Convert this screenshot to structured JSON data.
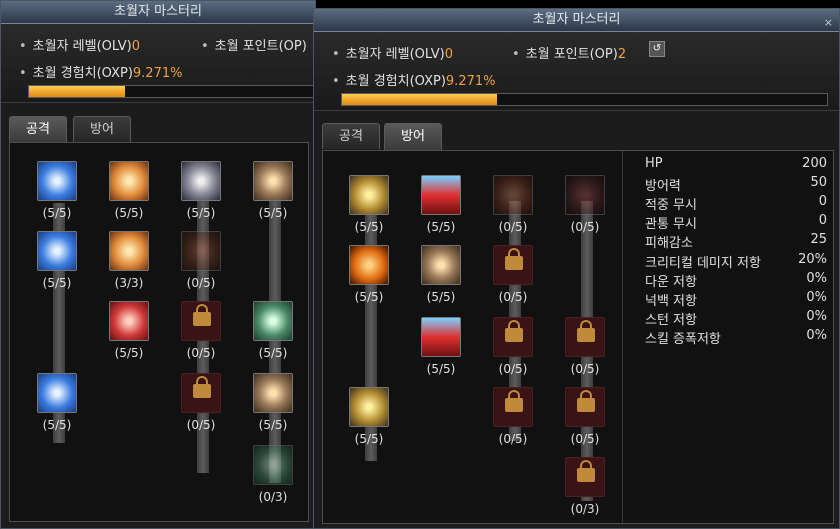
{
  "back_window": {
    "title": "초월자 마스터리",
    "level_label": "초월자 레벨(OLV)",
    "level_value": "0",
    "point_label": "초월 포인트(OP)",
    "exp_label": "초월 경험치(OXP)",
    "exp_value": "9.271%",
    "exp_progress": 0.33,
    "tabs": [
      "공격",
      "방어"
    ],
    "active_tab": "공격",
    "skills": [
      {
        "icon": "crossed-swords-icon",
        "level": "(5/5)",
        "locked": false
      },
      {
        "icon": "flaming-fist-icon",
        "level": "(5/5)",
        "locked": false
      },
      {
        "icon": "fist-whirl-icon",
        "level": "(5/5)",
        "locked": false
      },
      {
        "icon": "chain-fist-icon",
        "level": "(5/5)",
        "locked": false
      },
      {
        "icon": "crossed-swords-icon",
        "level": "(5/5)",
        "locked": false
      },
      {
        "icon": "flaming-fist-icon",
        "level": "(3/3)",
        "locked": false
      },
      {
        "icon": "shield-crest-icon",
        "level": "(0/5)",
        "locked": false
      },
      {
        "icon": "red-arrow-fist-icon",
        "level": "(5/5)",
        "locked": false
      },
      {
        "icon": "lock-icon",
        "level": "(0/5)",
        "locked": true
      },
      {
        "icon": "swirl-arrows-icon",
        "level": "(5/5)",
        "locked": false
      },
      {
        "icon": "crossed-swords-icon",
        "level": "(5/5)",
        "locked": false
      },
      {
        "icon": "lock-icon",
        "level": "(0/5)",
        "locked": true
      },
      {
        "icon": "chain-fist-icon",
        "level": "(5/5)",
        "locked": false
      },
      {
        "icon": "swirl-arrows-icon",
        "level": "(0/3)",
        "locked": false
      }
    ]
  },
  "front_window": {
    "title": "초월자 마스터리",
    "close_icon": "close-icon",
    "level_label": "초월자 레벨(OLV)",
    "level_value": "0",
    "point_label": "초월 포인트(OP)",
    "point_value": "2",
    "exp_label": "초월 경험치(OXP)",
    "exp_value": "9.271%",
    "exp_progress": 0.32,
    "tabs": [
      "공격",
      "방어"
    ],
    "active_tab": "방어",
    "skills": [
      {
        "icon": "golden-shield-icon",
        "level": "(5/5)",
        "locked": false
      },
      {
        "icon": "red-potion-icon",
        "level": "(5/5)",
        "locked": false
      },
      {
        "icon": "figure-icon",
        "level": "(0/5)",
        "locked": false
      },
      {
        "icon": "x-mark-icon",
        "level": "(0/5)",
        "locked": false
      },
      {
        "icon": "burning-silhouette-icon",
        "level": "(5/5)",
        "locked": false
      },
      {
        "icon": "chain-fist-icon",
        "level": "(5/5)",
        "locked": false
      },
      {
        "icon": "lock-icon",
        "level": "(0/5)",
        "locked": true
      },
      {
        "icon": "red-potion-icon",
        "level": "(5/5)",
        "locked": false
      },
      {
        "icon": "lock-icon",
        "level": "(0/5)",
        "locked": true
      },
      {
        "icon": "lock-icon",
        "level": "(0/5)",
        "locked": true
      },
      {
        "icon": "golden-shield-icon",
        "level": "(5/5)",
        "locked": false
      },
      {
        "icon": "lock-icon",
        "level": "(0/5)",
        "locked": true
      },
      {
        "icon": "lock-icon",
        "level": "(0/5)",
        "locked": true
      },
      {
        "icon": "lock-icon",
        "level": "(0/3)",
        "locked": true
      }
    ],
    "stats": [
      {
        "name": "HP",
        "value": "200"
      },
      {
        "name": "방어력",
        "value": "50"
      },
      {
        "name": "적중 무시",
        "value": "0"
      },
      {
        "name": "관통 무시",
        "value": "0"
      },
      {
        "name": "피해감소",
        "value": "25"
      },
      {
        "name": "크리티컬 데미지 저항",
        "value": "20%"
      },
      {
        "name": "다운 저항",
        "value": "0%"
      },
      {
        "name": "넉백 저항",
        "value": "0%"
      },
      {
        "name": "스턴 저항",
        "value": "0%"
      },
      {
        "name": "스킬 증폭저항",
        "value": "0%"
      }
    ]
  },
  "colors": {
    "accent_orange": "#f0a040",
    "exp_bar": "#e08a10",
    "locked_slot": "#3a1414",
    "title_bar": "#3d4a5c"
  }
}
